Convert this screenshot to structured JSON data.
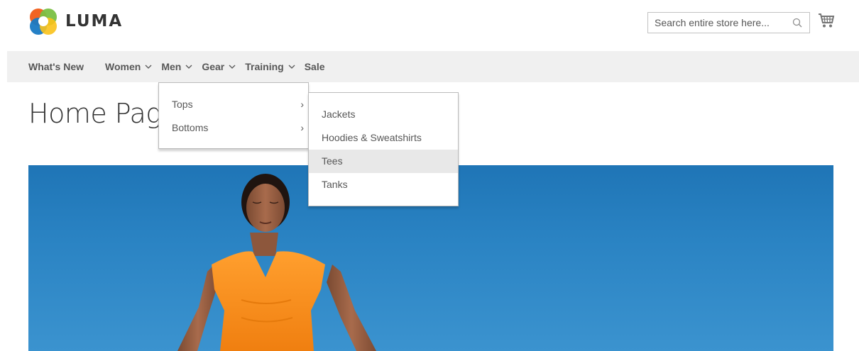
{
  "brand": {
    "name": "LUMA"
  },
  "search": {
    "placeholder": "Search entire store here..."
  },
  "nav": {
    "items": [
      {
        "label": "What's New",
        "has_dropdown": false
      },
      {
        "label": "Women",
        "has_dropdown": true
      },
      {
        "label": "Men",
        "has_dropdown": true
      },
      {
        "label": "Gear",
        "has_dropdown": true
      },
      {
        "label": "Training",
        "has_dropdown": true
      },
      {
        "label": "Sale",
        "has_dropdown": false
      }
    ]
  },
  "men_menu": {
    "items": [
      {
        "label": "Tops"
      },
      {
        "label": "Bottoms"
      }
    ]
  },
  "tops_menu": {
    "items": [
      {
        "label": "Jackets"
      },
      {
        "label": "Hoodies & Sweatshirts"
      },
      {
        "label": "Tees",
        "active": true
      },
      {
        "label": "Tanks"
      }
    ]
  },
  "page": {
    "title": "Home Page"
  },
  "colors": {
    "nav_bg": "#f0f0f0",
    "hero_sky": "#2a83c3",
    "shirt": "#f7941d"
  }
}
